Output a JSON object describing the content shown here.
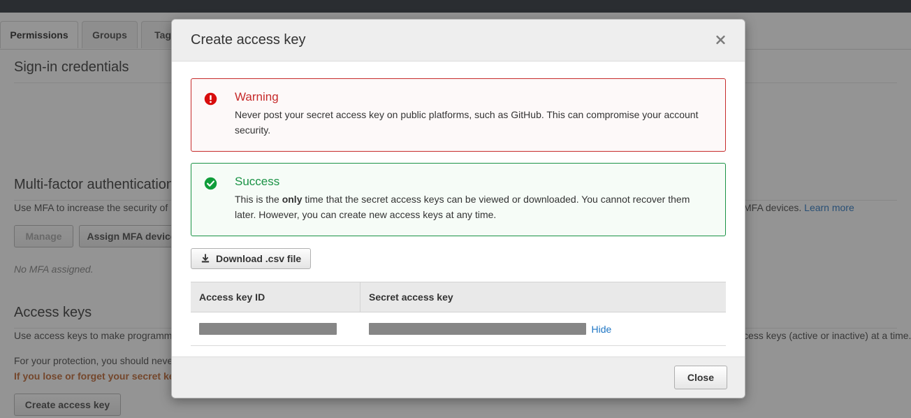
{
  "background": {
    "tabs": [
      {
        "label": "Permissions",
        "active": true
      },
      {
        "label": "Groups",
        "active": false
      },
      {
        "label": "Tags",
        "active": false
      }
    ],
    "signin_section": {
      "title": "Sign-in credentials"
    },
    "mfa_section": {
      "title": "Multi-factor authentication (MFA)",
      "description_left": "Use MFA to increase the security of",
      "description_right": "MFA devices.",
      "learn_more_label": "Learn more",
      "manage_button": "Manage",
      "assign_button": "Assign MFA device",
      "status": "No MFA assigned."
    },
    "access_keys_section": {
      "title": "Access keys",
      "description_line1": "Use access keys to make programm",
      "description_line2": "For your protection, you should neve",
      "description_right": "cess keys (active or inactive) at a time.",
      "warning_line": "If you lose or forget your secret ke",
      "create_button": "Create access key"
    }
  },
  "modal": {
    "title": "Create access key",
    "close_icon_label": "✖",
    "warning": {
      "heading": "Warning",
      "text_part1": "Never post your secret access key on public platforms, such as GitHub. This can compromise your",
      "text_part2": "account security."
    },
    "success": {
      "heading": "Success",
      "text_before_bold": "This is the ",
      "bold_word": "only",
      "text_after_bold": " time that the secret access keys can be viewed or downloaded. You cannot recover them later. However, you can create new access keys at any time."
    },
    "download_button": "Download .csv file",
    "table": {
      "headers": [
        "Access key ID",
        "Secret access key"
      ],
      "rows": [
        {
          "access_key_id": "",
          "secret_access_key": "",
          "toggle_label": "Hide"
        }
      ]
    },
    "footer": {
      "close_button": "Close"
    }
  },
  "colors": {
    "topbar": "#141c24",
    "warning_red": "#c62b2b",
    "success_green": "#1a9245",
    "link_blue": "#1f76c4",
    "orange_warning": "#b8541a",
    "redaction_gray": "#868686"
  }
}
